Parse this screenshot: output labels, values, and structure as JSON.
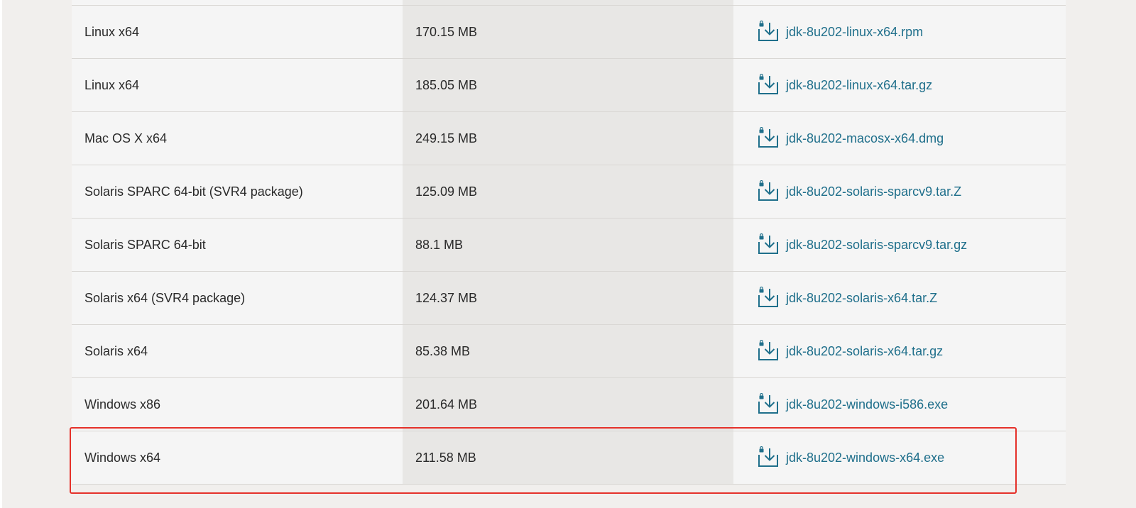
{
  "colors": {
    "link": "#1f6f8b",
    "highlight": "#e5312a",
    "col_light": "#f5f5f5",
    "col_dark": "#e8e7e5",
    "page_bg": "#f1efed"
  },
  "downloads": {
    "icon": "download-lock-icon",
    "rows": [
      {
        "os": "Linux x64",
        "size": "170.15 MB",
        "file": "jdk-8u202-linux-x64.rpm"
      },
      {
        "os": "Linux x64",
        "size": "185.05 MB",
        "file": "jdk-8u202-linux-x64.tar.gz"
      },
      {
        "os": "Mac OS X x64",
        "size": "249.15 MB",
        "file": "jdk-8u202-macosx-x64.dmg"
      },
      {
        "os": "Solaris SPARC 64-bit (SVR4 package)",
        "size": "125.09 MB",
        "file": "jdk-8u202-solaris-sparcv9.tar.Z"
      },
      {
        "os": "Solaris SPARC 64-bit",
        "size": "88.1 MB",
        "file": "jdk-8u202-solaris-sparcv9.tar.gz"
      },
      {
        "os": "Solaris x64 (SVR4 package)",
        "size": "124.37 MB",
        "file": "jdk-8u202-solaris-x64.tar.Z"
      },
      {
        "os": "Solaris x64",
        "size": "85.38 MB",
        "file": "jdk-8u202-solaris-x64.tar.gz"
      },
      {
        "os": "Windows x86",
        "size": "201.64 MB",
        "file": "jdk-8u202-windows-i586.exe"
      },
      {
        "os": "Windows x64",
        "size": "211.58 MB",
        "file": "jdk-8u202-windows-x64.exe"
      }
    ]
  }
}
